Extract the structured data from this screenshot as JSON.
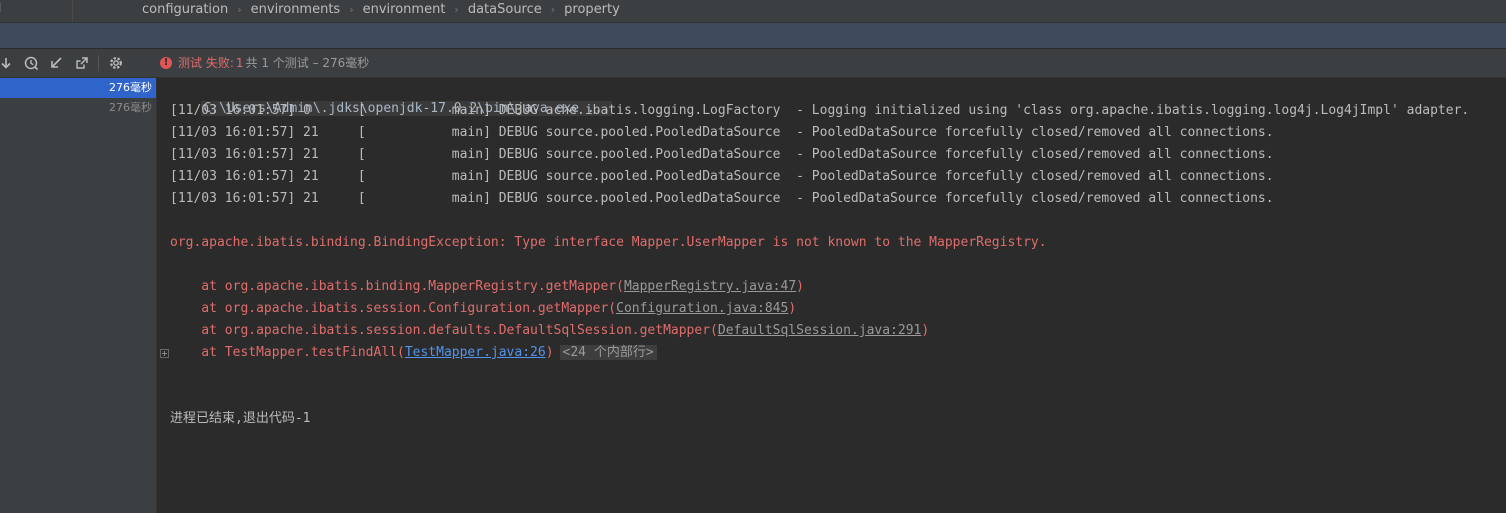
{
  "breadcrumb": {
    "left_stub": "l",
    "items": [
      "configuration",
      "environments",
      "environment",
      "dataSource",
      "property"
    ]
  },
  "toolbar": {
    "icons": [
      "arrow-down-icon",
      "history-icon",
      "import-icon",
      "export-icon",
      "gear-icon"
    ]
  },
  "status": {
    "icon": "error-icon",
    "icon_glyph": "!",
    "label": "测试 失败:",
    "count": "1",
    "rest": "共 1 个测试 – 276毫秒"
  },
  "tree": [
    {
      "time": "276毫秒",
      "selected": true
    },
    {
      "time": "276毫秒",
      "selected": false
    }
  ],
  "console": {
    "command": "C:\\Users\\Admin\\.jdks\\openjdk-17.0.2\\bin\\java.exe ...",
    "debug_lines": [
      "[11/03 16:01:57] 0      [           main] DEBUG ache.ibatis.logging.LogFactory  - Logging initialized using 'class org.apache.ibatis.logging.log4j.Log4jImpl' adapter.",
      "[11/03 16:01:57] 21     [           main] DEBUG source.pooled.PooledDataSource  - PooledDataSource forcefully closed/removed all connections.",
      "[11/03 16:01:57] 21     [           main] DEBUG source.pooled.PooledDataSource  - PooledDataSource forcefully closed/removed all connections.",
      "[11/03 16:01:57] 21     [           main] DEBUG source.pooled.PooledDataSource  - PooledDataSource forcefully closed/removed all connections.",
      "[11/03 16:01:57] 21     [           main] DEBUG source.pooled.PooledDataSource  - PooledDataSource forcefully closed/removed all connections."
    ],
    "exception": "org.apache.ibatis.binding.BindingException: Type interface Mapper.UserMapper is not known to the MapperRegistry.",
    "trace": [
      {
        "prefix": "    at org.apache.ibatis.binding.MapperRegistry.getMapper(",
        "link": "MapperRegistry.java:47",
        "suffix": ")"
      },
      {
        "prefix": "    at org.apache.ibatis.session.Configuration.getMapper(",
        "link": "Configuration.java:845",
        "suffix": ")"
      },
      {
        "prefix": "    at org.apache.ibatis.session.defaults.DefaultSqlSession.getMapper(",
        "link": "DefaultSqlSession.java:291",
        "suffix": ")"
      },
      {
        "prefix": "    at TestMapper.testFindAll(",
        "link": "TestMapper.java:26",
        "suffix": ")",
        "folded": "<24 个内部行>"
      }
    ],
    "exit_message": "进程已结束,退出代码-1"
  },
  "colors": {
    "accent_selection": "#2f65ca",
    "error": "#e06c6c",
    "link_blue": "#5394ec"
  }
}
